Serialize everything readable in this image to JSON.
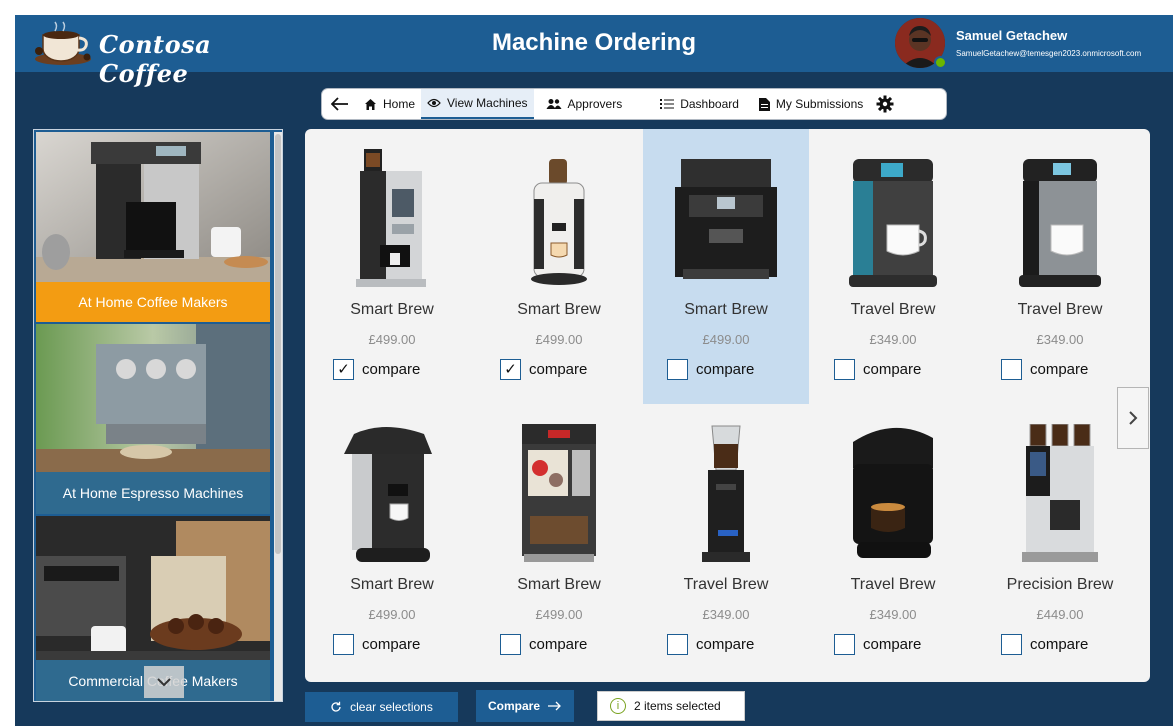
{
  "header": {
    "logo_text": "Contosa Coffee",
    "title": "Machine Ordering",
    "user_name": "Samuel Getachew",
    "user_email": "SamuelGetachew@temesgen2023.onmicrosoft.com"
  },
  "nav": {
    "items": [
      {
        "label": "Home",
        "icon": "home-icon"
      },
      {
        "label": "View Machines",
        "icon": "eye-icon"
      },
      {
        "label": "Approvers",
        "icon": "people-icon"
      },
      {
        "label": "Dashboard",
        "icon": "list-icon"
      },
      {
        "label": "My Submissions",
        "icon": "document-icon"
      }
    ],
    "active": "View Machines"
  },
  "sidebar": {
    "categories": [
      {
        "label": "At Home Coffee Makers"
      },
      {
        "label": "At Home Espresso Machines"
      },
      {
        "label": "Commercial Coffee Makers"
      }
    ]
  },
  "products": [
    {
      "name": "Smart Brew",
      "price": "£499.00",
      "compare_label": "compare",
      "checked": true,
      "selected": false
    },
    {
      "name": "Smart Brew",
      "price": "£499.00",
      "compare_label": "compare",
      "checked": true,
      "selected": false
    },
    {
      "name": "Smart Brew",
      "price": "£499.00",
      "compare_label": "compare",
      "checked": false,
      "selected": true
    },
    {
      "name": "Travel Brew",
      "price": "£349.00",
      "compare_label": "compare",
      "checked": false,
      "selected": false
    },
    {
      "name": "Travel Brew",
      "price": "£349.00",
      "compare_label": "compare",
      "checked": false,
      "selected": false
    },
    {
      "name": "Smart Brew",
      "price": "£499.00",
      "compare_label": "compare",
      "checked": false,
      "selected": false
    },
    {
      "name": "Smart Brew",
      "price": "£499.00",
      "compare_label": "compare",
      "checked": false,
      "selected": false
    },
    {
      "name": "Travel Brew",
      "price": "£349.00",
      "compare_label": "compare",
      "checked": false,
      "selected": false
    },
    {
      "name": "Travel Brew",
      "price": "£349.00",
      "compare_label": "compare",
      "checked": false,
      "selected": false
    },
    {
      "name": "Precision Brew",
      "price": "£449.00",
      "compare_label": "compare",
      "checked": false,
      "selected": false
    }
  ],
  "actions": {
    "clear_label": "clear selections",
    "compare_label": "Compare",
    "selected_info": "2 items selected"
  },
  "colors": {
    "header_bg": "#1d5d93",
    "app_bg": "#16395b",
    "accent_orange": "#f39c12",
    "selected_card": "#c7dcef"
  }
}
